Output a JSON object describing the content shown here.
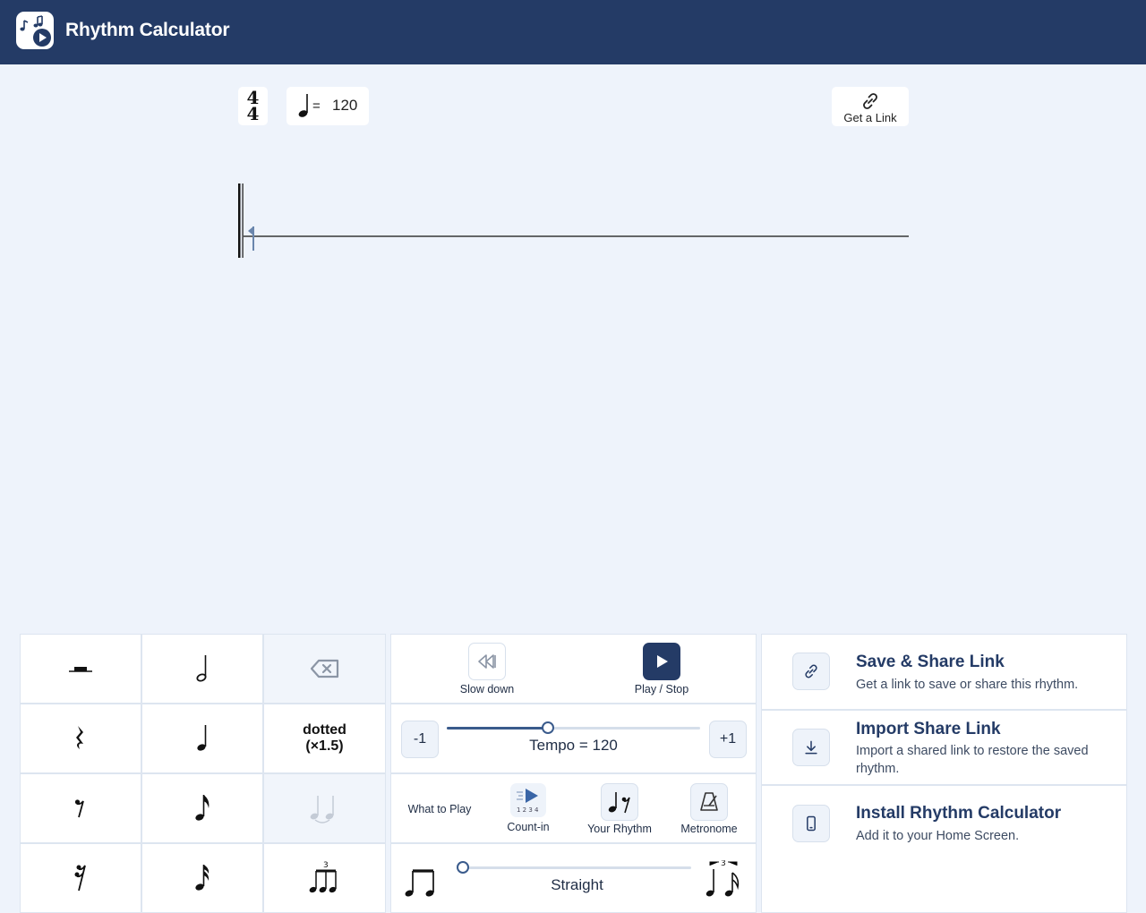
{
  "header": {
    "title": "Rhythm Calculator",
    "background": "#243b66"
  },
  "score": {
    "time_signature": {
      "top": "4",
      "bottom": "4"
    },
    "tempo_equals": "=",
    "tempo_value": "120",
    "get_link_label": "Get a Link"
  },
  "palette": {
    "dotted_line1": "dotted",
    "dotted_line2": "(×1.5)",
    "triplet_number": "3"
  },
  "playback": {
    "slow_down_label": "Slow down",
    "play_stop_label": "Play / Stop",
    "minus_label": "-1",
    "plus_label": "+1",
    "tempo_label": "Tempo = 120",
    "tempo_slider_fraction": 0.4,
    "what_to_play_label": "What to Play",
    "count_in_label": "Count-in",
    "count_in_digits": "1 2 3 4",
    "your_rhythm_label": "Your Rhythm",
    "metronome_label": "Metronome",
    "swing_label": "Straight",
    "swing_slider_fraction": 0.0,
    "swing_triplet_number": "3"
  },
  "actions": [
    {
      "title": "Save & Share Link",
      "description": "Get a link to save or share this rhythm.",
      "icon": "link-icon"
    },
    {
      "title": "Import Share Link",
      "description": "Import a shared link to restore the saved rhythm.",
      "icon": "download-icon"
    },
    {
      "title": "Install Rhythm Calculator",
      "description": "Add it to your Home Screen.",
      "icon": "phone-icon"
    }
  ]
}
